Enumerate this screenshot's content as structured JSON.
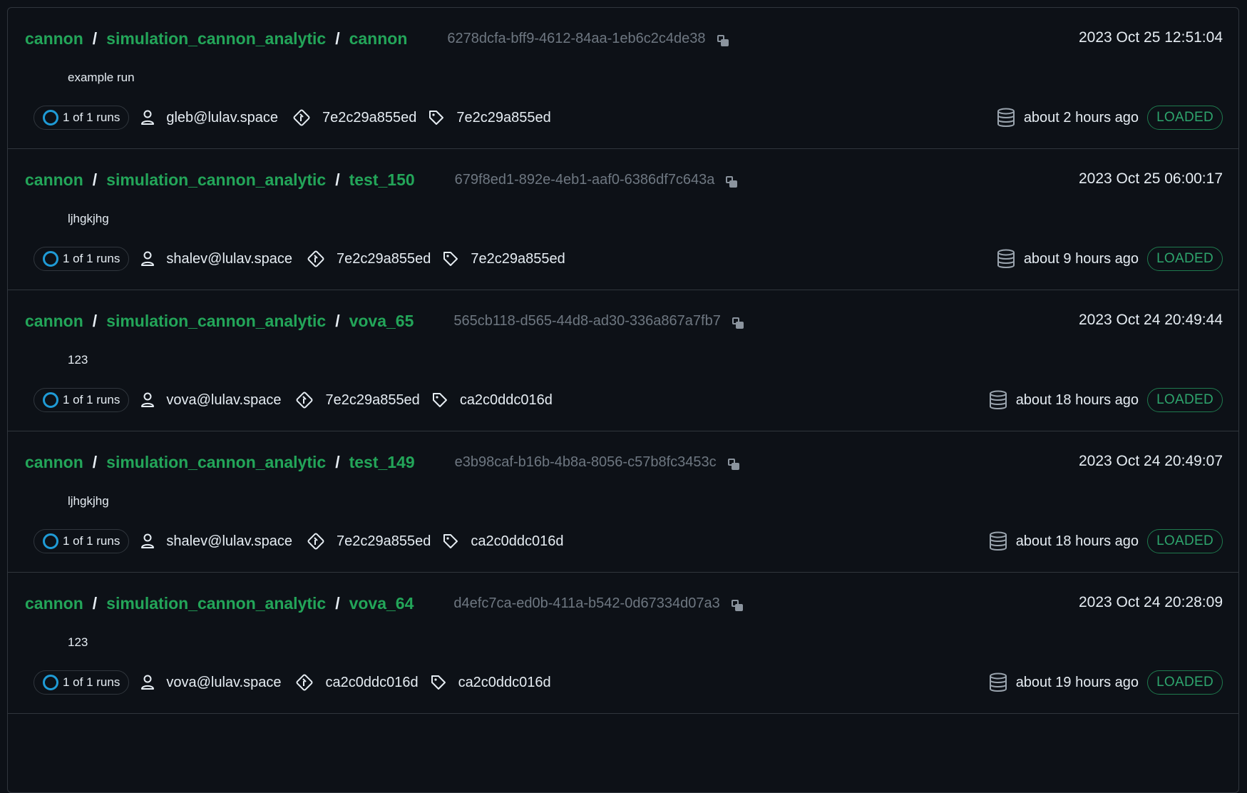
{
  "colors": {
    "background": "#0d1117",
    "border": "#30363d",
    "accent_green": "#23a559",
    "status_blue": "#1f9bd6",
    "loaded_green": "#2ea56d",
    "muted_text": "#6e7781"
  },
  "icons": {
    "status": "status-ring-icon",
    "copy": "copy-icon",
    "user": "user-icon",
    "commit": "git-commit-icon",
    "tag": "tag-icon",
    "storage": "database-icon"
  },
  "runs": [
    {
      "project": "cannon",
      "experiment": "simulation_cannon_analytic",
      "name": "cannon",
      "run_id": "6278dcfa-bff9-4612-84aa-1eb6c2c4de38",
      "timestamp": "2023 Oct 25 12:51:04",
      "description": "example run",
      "runs_count": "1 of 1 runs",
      "user": "gleb@lulav.space",
      "commit": "7e2c29a855ed",
      "tag": "7e2c29a855ed",
      "age": "about 2 hours ago",
      "status": "LOADED"
    },
    {
      "project": "cannon",
      "experiment": "simulation_cannon_analytic",
      "name": "test_150",
      "run_id": "679f8ed1-892e-4eb1-aaf0-6386df7c643a",
      "timestamp": "2023 Oct 25 06:00:17",
      "description": "ljhgkjhg",
      "runs_count": "1 of 1 runs",
      "user": "shalev@lulav.space",
      "commit": "7e2c29a855ed",
      "tag": "7e2c29a855ed",
      "age": "about 9 hours ago",
      "status": "LOADED"
    },
    {
      "project": "cannon",
      "experiment": "simulation_cannon_analytic",
      "name": "vova_65",
      "run_id": "565cb118-d565-44d8-ad30-336a867a7fb7",
      "timestamp": "2023 Oct 24 20:49:44",
      "description": "123",
      "runs_count": "1 of 1 runs",
      "user": "vova@lulav.space",
      "commit": "7e2c29a855ed",
      "tag": "ca2c0ddc016d",
      "age": "about 18 hours ago",
      "status": "LOADED"
    },
    {
      "project": "cannon",
      "experiment": "simulation_cannon_analytic",
      "name": "test_149",
      "run_id": "e3b98caf-b16b-4b8a-8056-c57b8fc3453c",
      "timestamp": "2023 Oct 24 20:49:07",
      "description": "ljhgkjhg",
      "runs_count": "1 of 1 runs",
      "user": "shalev@lulav.space",
      "commit": "7e2c29a855ed",
      "tag": "ca2c0ddc016d",
      "age": "about 18 hours ago",
      "status": "LOADED"
    },
    {
      "project": "cannon",
      "experiment": "simulation_cannon_analytic",
      "name": "vova_64",
      "run_id": "d4efc7ca-ed0b-411a-b542-0d67334d07a3",
      "timestamp": "2023 Oct 24 20:28:09",
      "description": "123",
      "runs_count": "1 of 1 runs",
      "user": "vova@lulav.space",
      "commit": "ca2c0ddc016d",
      "tag": "ca2c0ddc016d",
      "age": "about 19 hours ago",
      "status": "LOADED"
    }
  ]
}
